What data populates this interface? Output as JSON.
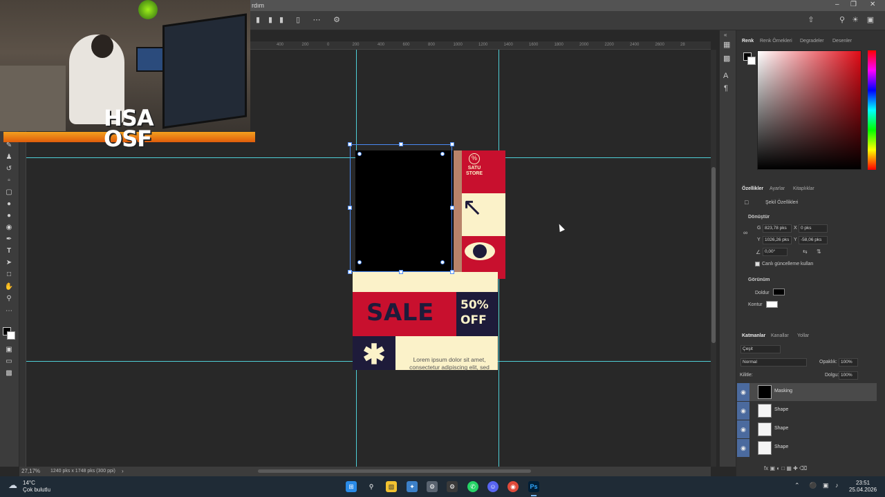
{
  "app": {
    "menu_partial": "rdım",
    "zoom": "27,17%",
    "doc_info": "1240 pks x 1748 pks (300 ppi)"
  },
  "ruler": {
    "ticks": [
      "400",
      "200",
      "0",
      "200",
      "400",
      "600",
      "800",
      "1000",
      "1200",
      "1400",
      "1600",
      "1800",
      "2000",
      "2200",
      "2400",
      "2600",
      "28"
    ]
  },
  "artboard": {
    "store_label": "SATU STORE",
    "store_icon": "percent-badge-icon",
    "sale_label": "SALE",
    "discount_label": "50% OFF",
    "body_text": "Lorem ipsum dolor sit amet, consectetur adipiscing elit, sed",
    "colors": {
      "cream": "#fbf2c9",
      "red": "#c8102e",
      "navy": "#1e1b3a"
    }
  },
  "webcam": {
    "logo": "HSA OSF"
  },
  "panels": {
    "color_tabs": [
      "Renk",
      "Renk Örnekleri",
      "Degradeler",
      "Desenler"
    ],
    "prop_tabs": [
      "Özellikler",
      "Ayarlar",
      "Kitaplıklar"
    ],
    "shape_props_title": "Şekil Özellikleri",
    "transform_title": "Dönüştür",
    "w_label": "G",
    "w_value": "823,78 pks",
    "x_label": "X",
    "x_value": "0 pks",
    "h_label": "Y",
    "h_value": "1026,26 pks",
    "y_label": "Y",
    "y_value": "-58,06 pks",
    "angle_value": "0,00°",
    "live_update_label": "Canlı güncelleme kullan",
    "appearance_title": "Görünüm",
    "fill_label": "Doldur",
    "stroke_label": "Kontur",
    "layer_tabs": [
      "Katmanlar",
      "Kanallar",
      "Yollar"
    ],
    "filter_label": "Çeşit",
    "blend_mode": "Normal",
    "opacity_label": "Opaklık:",
    "opacity_value": "100%",
    "lock_label": "Kilitle:",
    "fill_pct_label": "Dolgu:",
    "fill_pct_value": "100%",
    "layers": [
      {
        "name": "Masking"
      },
      {
        "name": "Shape"
      },
      {
        "name": "Shape"
      },
      {
        "name": "Shape"
      }
    ]
  },
  "taskbar": {
    "weather_temp": "14°C",
    "weather_text": "Çok bulutlu",
    "time": "23:51",
    "date": "25.04.2026"
  }
}
